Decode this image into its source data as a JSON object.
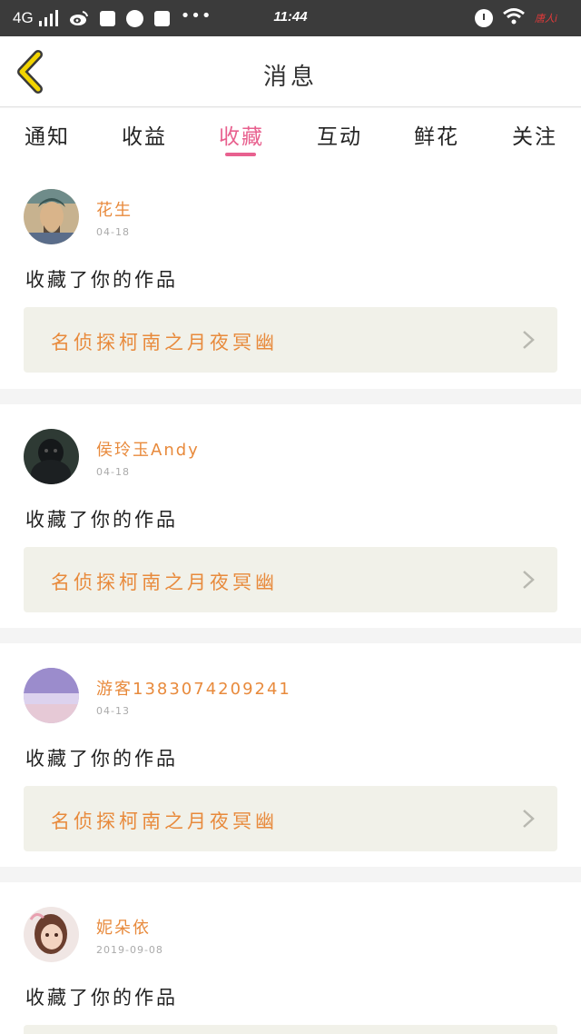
{
  "status_bar": {
    "network": "4G",
    "time": "11:44",
    "carrier_mark": "唐人i"
  },
  "header": {
    "title": "消息",
    "back_icon": "chevron-left-icon"
  },
  "tabs": [
    {
      "label": "通知",
      "active": false
    },
    {
      "label": "收益",
      "active": false
    },
    {
      "label": "收藏",
      "active": true
    },
    {
      "label": "互动",
      "active": false
    },
    {
      "label": "鲜花",
      "active": false
    },
    {
      "label": "关注",
      "active": false
    }
  ],
  "notifications": [
    {
      "username": "花生",
      "date": "04-18",
      "message": "收藏了你的作品",
      "work_title": "名侦探柯南之月夜冥幽"
    },
    {
      "username": "侯玲玉Andy",
      "date": "04-18",
      "message": "收藏了你的作品",
      "work_title": "名侦探柯南之月夜冥幽"
    },
    {
      "username": "游客1383074209241",
      "date": "04-13",
      "message": "收藏了你的作品",
      "work_title": "名侦探柯南之月夜冥幽"
    },
    {
      "username": "妮朵依",
      "date": "2019-09-08",
      "message": "收藏了你的作品",
      "work_title": ""
    }
  ],
  "colors": {
    "accent": "#e8618f",
    "username": "#e88a3c",
    "work_title": "#e88a3c",
    "back_icon": "#f2d400",
    "status_bar_bg": "#3b3b3b",
    "link_bg": "#f1f1e9"
  }
}
